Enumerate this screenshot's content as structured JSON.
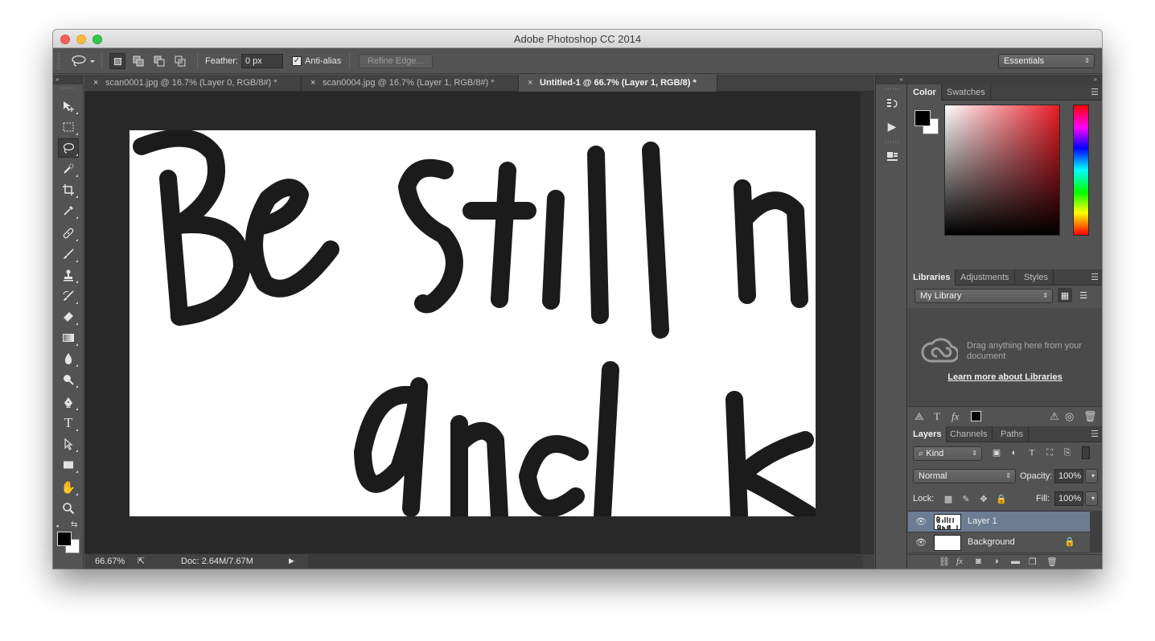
{
  "window": {
    "title": "Adobe Photoshop CC 2014"
  },
  "options_bar": {
    "feather_label": "Feather:",
    "feather_value": "0 px",
    "antialias_label": "Anti-alias",
    "antialias_checked": true,
    "refine_edge_label": "Refine Edge...",
    "workspace_select": "Essentials"
  },
  "document_tabs": [
    {
      "label": "scan0001.jpg @ 16.7% (Layer 0, RGB/8#) *",
      "active": false
    },
    {
      "label": "scan0004.jpg @ 16.7% (Layer 1, RGB/8#) *",
      "active": false
    },
    {
      "label": "Untitled-1 @ 66.7% (Layer 1, RGB/8) *",
      "active": true
    }
  ],
  "canvas": {
    "lettering_line1": "Be still m",
    "lettering_line2": "and k"
  },
  "status_bar": {
    "zoom": "66.67%",
    "doc_size": "Doc: 2.64M/7.67M"
  },
  "color_panel": {
    "tabs": [
      "Color",
      "Swatches"
    ],
    "foreground": "#000000",
    "background": "#ffffff"
  },
  "libraries_panel": {
    "tabs": [
      "Libraries",
      "Adjustments",
      "Styles"
    ],
    "library_select": "My Library",
    "drag_text": "Drag anything here from your document",
    "learn_more": "Learn more about Libraries"
  },
  "layers_panel": {
    "tabs": [
      "Layers",
      "Channels",
      "Paths"
    ],
    "filter_kind": "Kind",
    "blend_mode": "Normal",
    "opacity_label": "Opacity:",
    "opacity_value": "100%",
    "lock_label": "Lock:",
    "fill_label": "Fill:",
    "fill_value": "100%",
    "layers": [
      {
        "name": "Layer 1",
        "selected": true
      },
      {
        "name": "Background",
        "selected": false,
        "locked": true
      }
    ]
  },
  "tools": [
    "move-tool",
    "rectangular-marquee-tool",
    "lasso-tool",
    "quick-selection-tool",
    "crop-tool",
    "eyedropper-tool",
    "spot-healing-brush-tool",
    "brush-tool",
    "clone-stamp-tool",
    "history-brush-tool",
    "eraser-tool",
    "gradient-tool",
    "blur-tool",
    "dodge-tool",
    "pen-tool",
    "type-tool",
    "path-selection-tool",
    "rectangle-tool",
    "hand-tool",
    "zoom-tool"
  ],
  "colors": {
    "chrome": "#535353",
    "workspace": "#282828",
    "selected_layer": "#6b7c93"
  }
}
